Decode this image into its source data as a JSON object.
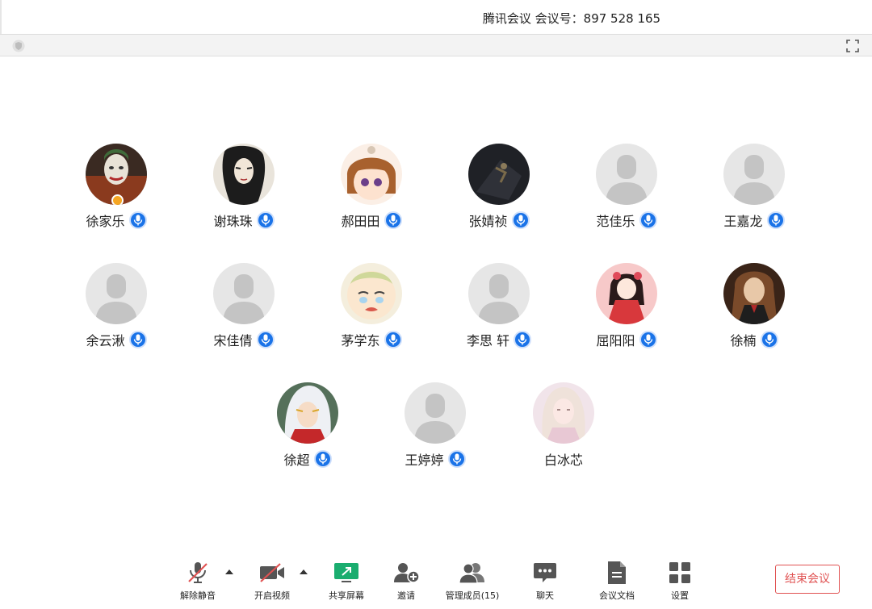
{
  "window": {
    "title": "腾讯会议 会议号：897 528 165"
  },
  "participants": [
    {
      "name": "徐家乐",
      "avatar": "joker-photo",
      "host": true,
      "mic": true
    },
    {
      "name": "谢珠珠",
      "avatar": "manga-girl-dark-hair",
      "mic": true
    },
    {
      "name": "郝田田",
      "avatar": "anime-girl-brown-hair",
      "mic": true
    },
    {
      "name": "张婧祯",
      "avatar": "dark-photo",
      "mic": true
    },
    {
      "name": "范佳乐",
      "avatar": "default-avatar",
      "mic": true
    },
    {
      "name": "王嘉龙",
      "avatar": "default-avatar",
      "mic": true
    },
    {
      "name": "余云湫",
      "avatar": "default-avatar",
      "mic": true
    },
    {
      "name": "宋佳倩",
      "avatar": "default-avatar",
      "mic": true
    },
    {
      "name": "茅学东",
      "avatar": "crying-baby-cartoon",
      "mic": true
    },
    {
      "name": "李思 轩",
      "avatar": "default-avatar",
      "mic": true
    },
    {
      "name": "屈阳阳",
      "avatar": "kimono-girl-pink",
      "mic": true
    },
    {
      "name": "徐楠",
      "avatar": "girl-portrait-photo",
      "mic": true
    },
    {
      "name": "徐超",
      "avatar": "inuyasha-anime",
      "mic": true
    },
    {
      "name": "王婷婷",
      "avatar": "default-avatar",
      "mic": true
    },
    {
      "name": "白冰芯",
      "avatar": "girl-pink-photo",
      "mic": false
    }
  ],
  "toolbar": {
    "unmute": "解除静音",
    "start_video": "开启视频",
    "share_screen": "共享屏幕",
    "invite": "邀请",
    "manage_members": "管理成员(15)",
    "chat": "聊天",
    "meeting_docs": "会议文档",
    "settings": "设置",
    "end_meeting": "结束会议"
  },
  "colors": {
    "accent": "#1a73e8",
    "end": "#e05252",
    "share": "#1aad6f"
  }
}
